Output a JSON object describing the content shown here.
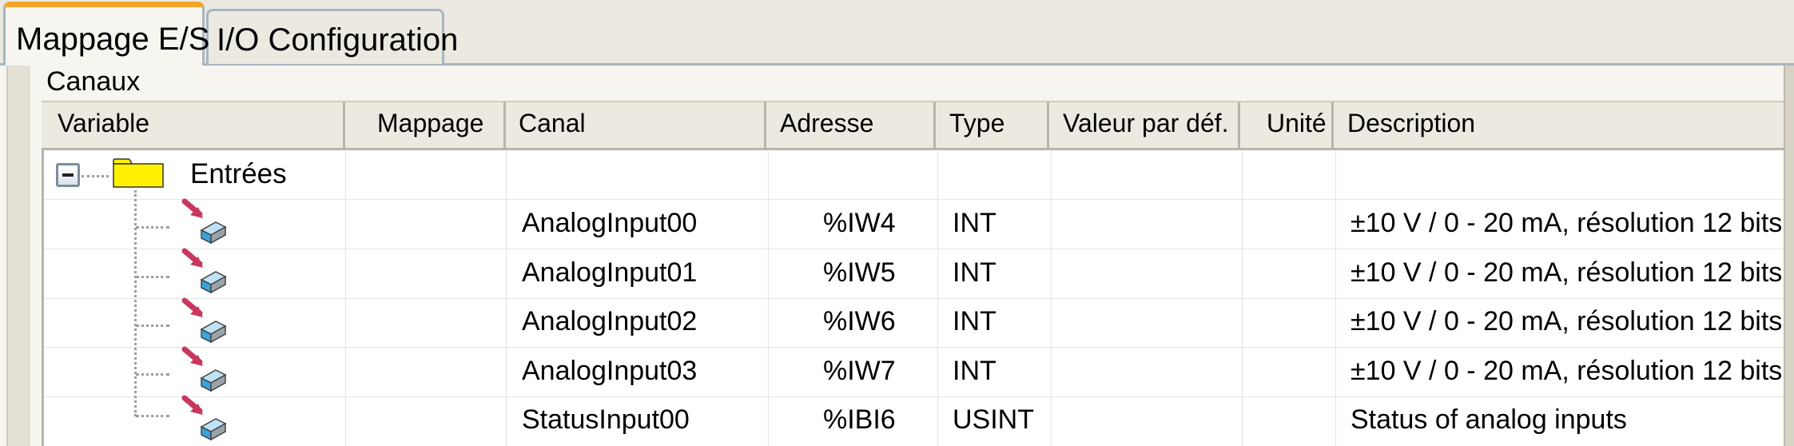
{
  "tabs": [
    {
      "label": "Mappage E/S",
      "active": true
    },
    {
      "label": "I/O Configuration",
      "active": false
    }
  ],
  "group_title": "Canaux",
  "columns": [
    "Variable",
    "Mappage",
    "Canal",
    "Adresse",
    "Type",
    "Valeur par déf.",
    "Unité",
    "Description"
  ],
  "tree": {
    "root_label": "Entrées",
    "root_icon": "folder-icon",
    "expander_icon": "collapse-minus-icon",
    "channel_icon": "input-channel-icon"
  },
  "rows": [
    {
      "canal": "AnalogInput00",
      "adresse": "%IW4",
      "type": "INT",
      "description": "±10 V / 0 - 20 mA, résolution 12 bits"
    },
    {
      "canal": "AnalogInput01",
      "adresse": "%IW5",
      "type": "INT",
      "description": "±10 V / 0 - 20 mA, résolution 12 bits"
    },
    {
      "canal": "AnalogInput02",
      "adresse": "%IW6",
      "type": "INT",
      "description": "±10 V / 0 - 20 mA, résolution 12 bits"
    },
    {
      "canal": "AnalogInput03",
      "adresse": "%IW7",
      "type": "INT",
      "description": "±10 V / 0 - 20 mA, résolution 12 bits"
    },
    {
      "canal": "StatusInput00",
      "adresse": "%IBI6",
      "type": "USINT",
      "description": "Status of analog inputs"
    }
  ],
  "colors": {
    "active_tab_accent": "#f4a62b",
    "tab_border": "#a7b6c1",
    "panel_bg": "#f7f5ef",
    "header_bg": "#ece9e0",
    "folder_fill": "#fff200",
    "arrow": "#c8375e",
    "channel_block": "#3ba3dc"
  }
}
